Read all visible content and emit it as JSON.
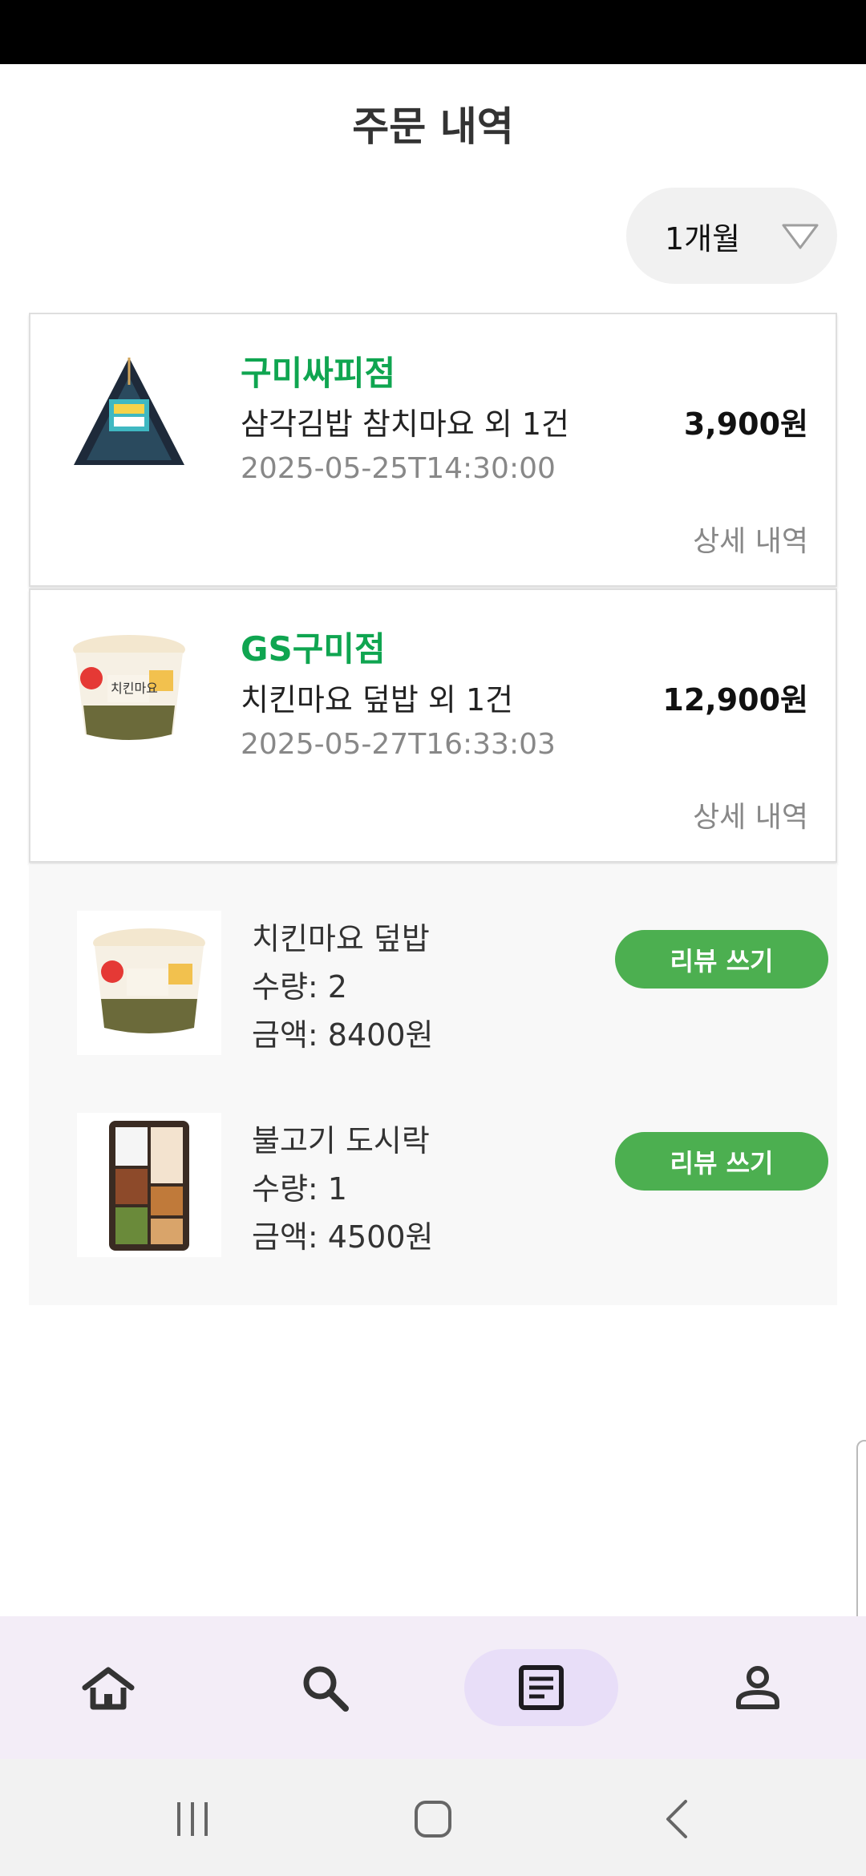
{
  "page": {
    "title": "주문 내역"
  },
  "filter": {
    "period": "1개월"
  },
  "orders": [
    {
      "store": "구미싸피점",
      "product": "삼각김밥 참치마요 외 1건",
      "datetime": "2025-05-25T14:30:00",
      "price": "3,900원",
      "detail_label": "상세 내역",
      "thumb_icon": "triangle-kimbap-image"
    },
    {
      "store": "GS구미점",
      "product": "치킨마요 덮밥 외 1건",
      "datetime": "2025-05-27T16:33:03",
      "price": "12,900원",
      "detail_label": "상세 내역",
      "thumb_icon": "rice-cup-image"
    }
  ],
  "order_items": [
    {
      "name": "치킨마요 덮밥",
      "quantity": "수량: 2",
      "amount": "금액: 8400원",
      "review_label": "리뷰 쓰기"
    },
    {
      "name": "불고기 도시락",
      "quantity": "수량: 1",
      "amount": "금액: 4500원",
      "review_label": "리뷰 쓰기"
    }
  ],
  "bottom_nav": {
    "items": [
      {
        "icon": "home-icon",
        "active": false
      },
      {
        "icon": "search-icon",
        "active": false
      },
      {
        "icon": "order-list-icon",
        "active": true
      },
      {
        "icon": "profile-icon",
        "active": false
      }
    ]
  },
  "colors": {
    "store_green": "#0fa550",
    "review_button": "#4caf50",
    "nav_background": "#f3edf7",
    "nav_active": "#e8def8"
  }
}
